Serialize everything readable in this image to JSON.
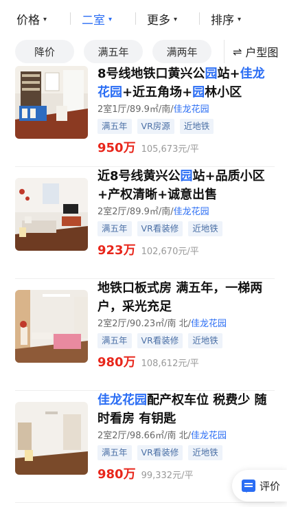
{
  "filters": {
    "price": "价格",
    "rooms": "二室",
    "more": "更多",
    "sort": "排序"
  },
  "quick_tags": [
    "降价",
    "满五年",
    "满两年"
  ],
  "layout_label": "户型图",
  "listings": [
    {
      "title_parts": [
        {
          "t": "8号线地铁口黄兴公"
        },
        {
          "t": "园",
          "hl": true
        },
        {
          "t": "站+"
        },
        {
          "t": "佳龙花园",
          "hl": true
        },
        {
          "t": "+近五角场+"
        },
        {
          "t": "园",
          "hl": true
        },
        {
          "t": "林小区"
        }
      ],
      "specs": "2室1厅/89.9㎡/南/",
      "community": "佳龙花园",
      "tags": [
        "满五年",
        "VR房源",
        "近地铁"
      ],
      "price": "950万",
      "unit_price": "105,673元/平"
    },
    {
      "title_parts": [
        {
          "t": "近8号线黄兴公"
        },
        {
          "t": "园",
          "hl": true
        },
        {
          "t": "站+品质小区+产权清晰+诚意出售"
        }
      ],
      "specs": "2室2厅/89.9㎡/南/",
      "community": "佳龙花园",
      "tags": [
        "满五年",
        "VR看装修",
        "近地铁"
      ],
      "price": "923万",
      "unit_price": "102,670元/平"
    },
    {
      "title_parts": [
        {
          "t": "地铁口板式房 满五年，一梯两户，采光充足"
        }
      ],
      "specs": "2室2厅/90.23㎡/南 北/",
      "community": "佳龙花园",
      "tags": [
        "满五年",
        "VR看装修",
        "近地铁"
      ],
      "price": "980万",
      "unit_price": "108,612元/平"
    },
    {
      "title_parts": [
        {
          "t": "佳龙花园",
          "hl": true
        },
        {
          "t": "配产权车位 税费少 随时看房 有钥匙"
        }
      ],
      "specs": "2室2厅/98.66㎡/南 北/",
      "community": "佳龙花园",
      "tags": [
        "满五年",
        "VR看装修",
        "近地铁"
      ],
      "price": "980万",
      "unit_price": "99,332元/平"
    }
  ],
  "float_button": "评价",
  "colors": {
    "accent": "#2a6df4",
    "price": "#e8261b",
    "chip_bg": "#eef3fa"
  }
}
